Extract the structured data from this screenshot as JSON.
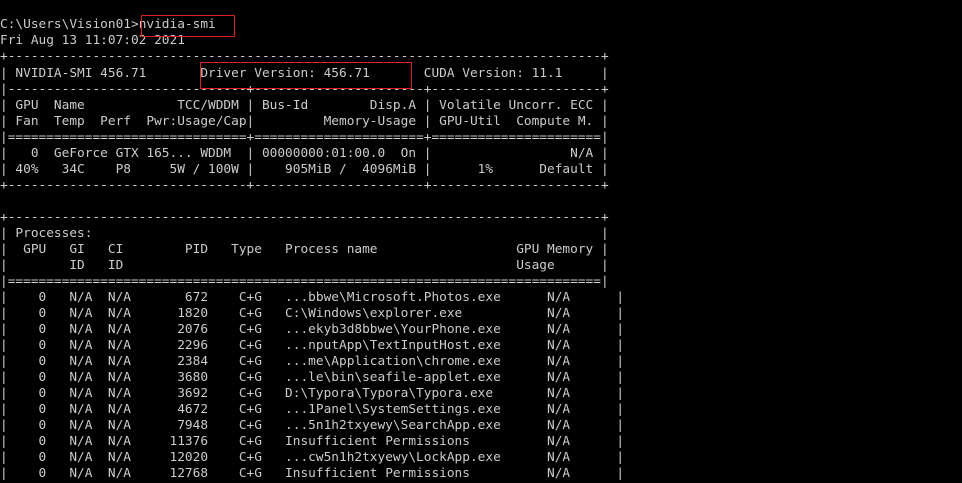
{
  "prompt": {
    "path": "C:\\Users\\Vision01>",
    "command": "nvidia-smi"
  },
  "timestamp": "Fri Aug 13 11:07:02 2021",
  "header": {
    "sep_top": "+-----------------------------------------------------------------------------+",
    "smi_version": "| NVIDIA-SMI 456.71       Driver Version: 456.71       CUDA Version: 11.1     |",
    "sep_mid": "|-------------------------------+----------------------+----------------------+",
    "col_row1": "| GPU  Name            TCC/WDDM | Bus-Id        Disp.A | Volatile Uncorr. ECC |",
    "col_row2": "| Fan  Temp  Perf  Pwr:Usage/Cap|         Memory-Usage | GPU-Util  Compute M. |",
    "sep_double": "|===============================+======================+======================|",
    "gpu_row1": "|   0  GeForce GTX 165... WDDM  | 00000000:01:00.0  On |                  N/A |",
    "gpu_row2": "| 40%   34C    P8     5W / 100W |    905MiB /  4096MiB |      1%      Default |",
    "sep_bottom": "+-------------------------------+----------------------+----------------------+"
  },
  "processes": {
    "sep_top": "+-----------------------------------------------------------------------------+",
    "title": "| Processes:                                                                  |",
    "col_row1": "|  GPU   GI   CI        PID   Type   Process name                  GPU Memory |",
    "col_row2": "|        ID   ID                                                   Usage      |",
    "sep_double": "|=============================================================================|",
    "rows": [
      "|    0   N/A  N/A       672    C+G   ...bbwe\\Microsoft.Photos.exe      N/A      |",
      "|    0   N/A  N/A      1820    C+G   C:\\Windows\\explorer.exe           N/A      |",
      "|    0   N/A  N/A      2076    C+G   ...ekyb3d8bbwe\\YourPhone.exe      N/A      |",
      "|    0   N/A  N/A      2296    C+G   ...nputApp\\TextInputHost.exe      N/A      |",
      "|    0   N/A  N/A      2384    C+G   ...me\\Application\\chrome.exe      N/A      |",
      "|    0   N/A  N/A      3680    C+G   ...le\\bin\\seafile-applet.exe      N/A      |",
      "|    0   N/A  N/A      3692    C+G   D:\\Typora\\Typora\\Typora.exe       N/A      |",
      "|    0   N/A  N/A      4672    C+G   ...1Panel\\SystemSettings.exe      N/A      |",
      "|    0   N/A  N/A      7948    C+G   ...5n1h2txyewy\\SearchApp.exe      N/A      |",
      "|    0   N/A  N/A     11376    C+G   Insufficient Permissions          N/A      |",
      "|    0   N/A  N/A     12020    C+G   ...cw5n1h2txyewy\\LockApp.exe      N/A      |",
      "|    0   N/A  N/A     12768    C+G   Insufficient Permissions          N/A      |"
    ]
  },
  "colors": {
    "background": "#000000",
    "text": "#cccccc",
    "highlight_box": "#e02020"
  }
}
